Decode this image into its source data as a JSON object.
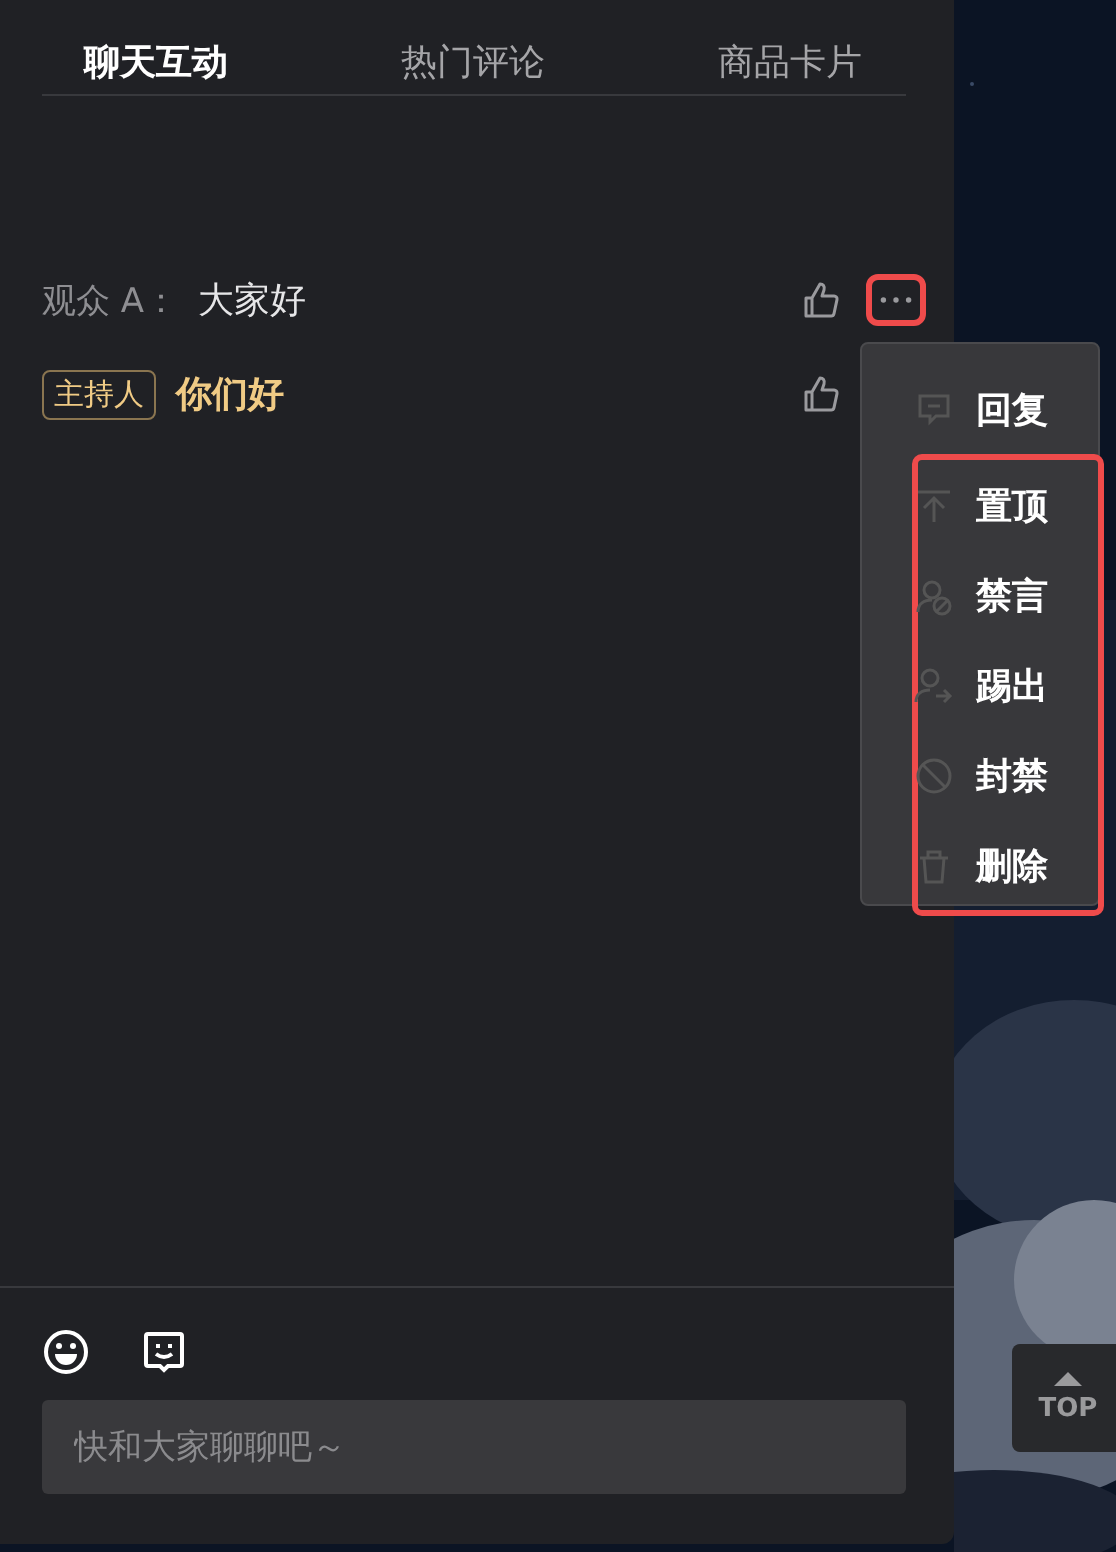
{
  "tabs": [
    {
      "label": "聊天互动",
      "selected": true
    },
    {
      "label": "热门评论",
      "selected": false
    },
    {
      "label": "商品卡片",
      "selected": false
    }
  ],
  "messages": [
    {
      "kind": "viewer",
      "sender": "观众 A：",
      "text": "大家好",
      "more_highlighted": true
    },
    {
      "kind": "host",
      "sender": "主持人",
      "text": "你们好",
      "more_highlighted": false
    }
  ],
  "menu": {
    "items": [
      {
        "kind": "reply",
        "label": "回复",
        "highlighted": false
      },
      {
        "kind": "pin",
        "label": "置顶",
        "highlighted": true
      },
      {
        "kind": "mute",
        "label": "禁言",
        "highlighted": true
      },
      {
        "kind": "kick",
        "label": "踢出",
        "highlighted": true
      },
      {
        "kind": "ban",
        "label": "封禁",
        "highlighted": true
      },
      {
        "kind": "delete",
        "label": "删除",
        "highlighted": true
      }
    ]
  },
  "input": {
    "placeholder": "快和大家聊聊吧～"
  },
  "top_button": {
    "label": "TOP"
  }
}
